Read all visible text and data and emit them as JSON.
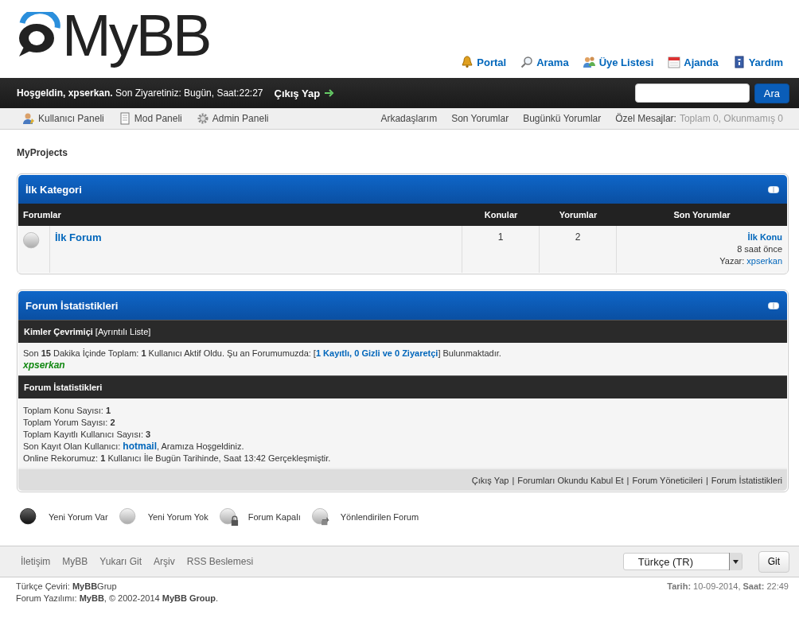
{
  "logo": {
    "text": "MyBB"
  },
  "top_links": [
    {
      "label": "Portal",
      "kind": "bell"
    },
    {
      "label": "Arama",
      "kind": "search"
    },
    {
      "label": "Üye Listesi",
      "kind": "members"
    },
    {
      "label": "Ajanda",
      "kind": "calendar"
    },
    {
      "label": "Yardım",
      "kind": "help"
    }
  ],
  "welcome": {
    "text": "**Hoşgeldin, xpserkan.** Son Ziyaretiniz: Bugün, Saat:22:27",
    "logout": "Çıkış Yap"
  },
  "search": {
    "button": "Ara"
  },
  "panel_links": [
    {
      "label": "Kullanıcı Paneli",
      "kind": "user"
    },
    {
      "label": "Mod Paneli",
      "kind": "notepad"
    },
    {
      "label": "Admin Paneli",
      "kind": "gear"
    }
  ],
  "user_links": [
    "Arkadaşlarım",
    "Son Yorumlar",
    "Bugünkü Yorumlar"
  ],
  "pm": {
    "label": "Özel Mesajlar:",
    "value": "Toplam 0, Okunmamış 0"
  },
  "breadcrumb": "MyProjects",
  "category": {
    "title": "İlk Kategori",
    "columns": [
      "Forumlar",
      "Konular",
      "Yorumlar",
      "Son Yorumlar"
    ],
    "forums": [
      {
        "name": "İlk Forum",
        "kind": "nonew",
        "threads": "1",
        "posts": "2",
        "last_post": {
          "title": "İlk Konu",
          "time": "8 saat önce",
          "author_label": "Yazar:",
          "author": "xpserkan"
        }
      }
    ]
  },
  "stats": {
    "title": "Forum İstatistikleri",
    "online_header": "Kimler Çevrimiçi",
    "online_link": "[Ayrıntılı Liste]",
    "online_text": {
      "pre": "Son **15** Dakika İçinde Toplam: **1** Kullanıcı Aktif Oldu. Şu an Forumumuzda: [",
      "link": "1 Kayıtlı, 0 Gizli ve 0 Ziyaretçi",
      "post": "] Bulunmaktadır."
    },
    "online_users": [
      "xpserkan"
    ],
    "stats_header": "Forum İstatistikleri",
    "lines": [
      {
        "pre": "Toplam Konu Sayısı: **1**"
      },
      {
        "pre": "Toplam Yorum Sayısı: **2**"
      },
      {
        "pre": "Toplam Kayıtlı Kullanıcı Sayısı: **3**"
      },
      {
        "pre": "Son Kayıt Olan Kullanıcı: ",
        "link": "hotmail",
        "post": ", Aramıza Hoşgeldiniz."
      },
      {
        "pre": "Online Rekorumuz: **1** Kullanıcı İle Bugün Tarihinde, Saat 13:42 Gerçekleşmiştir."
      }
    ],
    "footer_links": [
      "Çıkış Yap",
      "Forumları Okundu Kabul Et",
      "Forum Yöneticileri",
      "Forum İstatistikleri"
    ],
    "separator": "|"
  },
  "legend": [
    {
      "label": "Yeni Yorum Var",
      "kind": "new"
    },
    {
      "label": "Yeni Yorum Yok",
      "kind": "nonew"
    },
    {
      "label": "Forum Kapalı",
      "kind": "locked"
    },
    {
      "label": "Yönlendirilen Forum",
      "kind": "redirect"
    }
  ],
  "bottom_links": [
    "İletişim",
    "MyBB",
    "Yukarı Git",
    "Arşiv",
    "RSS Beslemesi"
  ],
  "language": {
    "value": "Türkçe (TR)"
  },
  "go_button": "Git",
  "credits": [
    "Türkçe Çeviri: **MyBB**Grup",
    "Forum Yazılımı: **MyBB**, © 2002-2014 **MyBB Group**."
  ],
  "date": "**Tarih:** 10-09-2014, **Saat:** 22:49"
}
